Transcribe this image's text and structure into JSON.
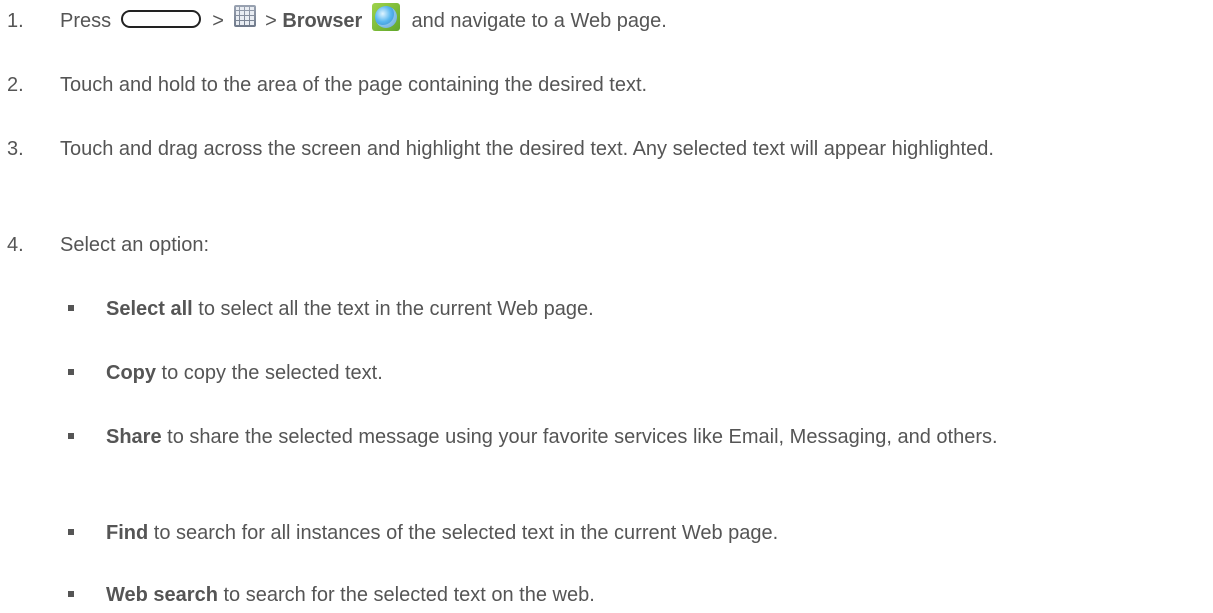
{
  "steps": [
    {
      "num": "1.",
      "pre": "Press",
      "sep1": ">",
      "sep2": ">",
      "bold": "Browser",
      "post": "and navigate to a Web page."
    },
    {
      "num": "2.",
      "text": "Touch and hold to the area of the page containing the desired text."
    },
    {
      "num": "3.",
      "text": "Touch and drag across the screen and highlight the desired text. Any selected text will appear highlighted."
    },
    {
      "num": "4.",
      "text": "Select an option:"
    }
  ],
  "options": [
    {
      "bold": "Select all",
      "text": " to select all the text in the current Web page."
    },
    {
      "bold": "Copy",
      "text": " to copy the selected text."
    },
    {
      "bold": "Share",
      "text": " to share the selected message using your favorite services like Email, Messaging, and others."
    },
    {
      "bold": "Find",
      "text": " to search for all instances of the selected text in the current Web page."
    },
    {
      "bold": "Web search",
      "text": " to search for the selected text on the web."
    }
  ],
  "icons": {
    "home": "home-key-icon",
    "apps": "apps-grid-icon",
    "browser": "browser-globe-icon"
  }
}
